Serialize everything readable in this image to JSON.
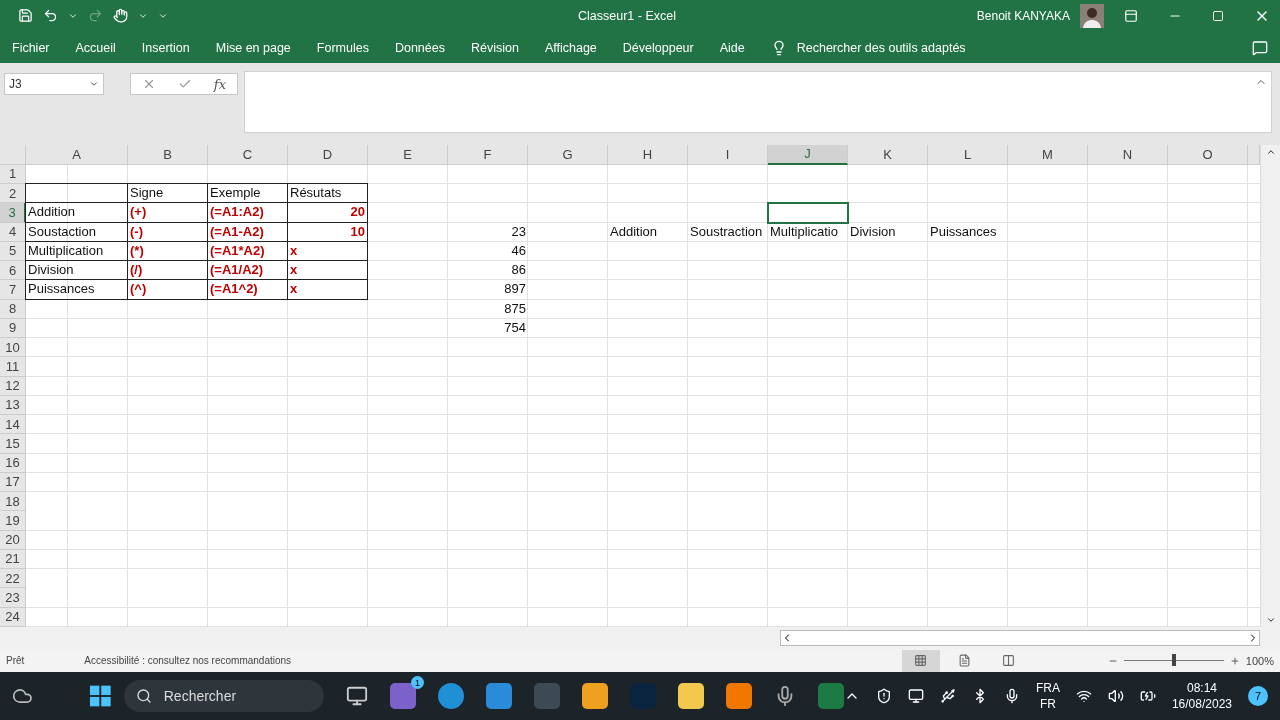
{
  "window": {
    "title": "Classeur1  -  Excel",
    "user": "Benoit KANYAKA"
  },
  "ribbon_tabs": [
    "Fichier",
    "Accueil",
    "Insertion",
    "Mise en page",
    "Formules",
    "Données",
    "Révision",
    "Affichage",
    "Développeur",
    "Aide"
  ],
  "tell_me": "Rechercher des outils adaptés",
  "formula_bar": {
    "name_box": "J3",
    "fx": "fx"
  },
  "sheet": {
    "columns": [
      {
        "label": "A",
        "selected": false
      },
      {
        "label": "B",
        "selected": false
      },
      {
        "label": "C",
        "selected": false
      },
      {
        "label": "D",
        "selected": false
      },
      {
        "label": "E",
        "selected": false
      },
      {
        "label": "F",
        "selected": false
      },
      {
        "label": "G",
        "selected": false
      },
      {
        "label": "H",
        "selected": false
      },
      {
        "label": "I",
        "selected": false
      },
      {
        "label": "J",
        "selected": true
      },
      {
        "label": "K",
        "selected": false
      },
      {
        "label": "L",
        "selected": false
      },
      {
        "label": "M",
        "selected": false
      },
      {
        "label": "N",
        "selected": false
      },
      {
        "label": "O",
        "selected": false
      }
    ],
    "rows": [
      {
        "label": "1",
        "selected": false
      },
      {
        "label": "2",
        "selected": false,
        "cells": [
          {
            "kind": "empty",
            "bordered": true
          },
          {
            "text": "Signe",
            "kind": "text",
            "bordered": true
          },
          {
            "text": "Exemple",
            "kind": "text",
            "bordered": true
          },
          {
            "text": "Résutats",
            "kind": "text",
            "bordered": true
          }
        ]
      },
      {
        "label": "3",
        "selected": true,
        "cells": [
          {
            "text": "Addition",
            "kind": "text",
            "bordered": true
          },
          {
            "text": "(+)",
            "kind": "red",
            "bordered": true
          },
          {
            "text": "(=A1:A2)",
            "kind": "red",
            "bordered": true
          },
          {
            "text": "20",
            "kind": "red-number",
            "bordered": true
          }
        ]
      },
      {
        "label": "4",
        "selected": false,
        "cells": [
          {
            "text": "Soustaction",
            "kind": "text",
            "bordered": true
          },
          {
            "text": "(-)",
            "kind": "red",
            "bordered": true
          },
          {
            "text": "(=A1-A2)",
            "kind": "red",
            "bordered": true
          },
          {
            "text": "10",
            "kind": "red-number",
            "bordered": true
          },
          {
            "kind": "empty",
            "bordered": false
          },
          {
            "text": "23",
            "kind": "number",
            "bordered": false
          },
          {
            "kind": "empty",
            "bordered": false
          },
          {
            "text": "Addition",
            "kind": "text",
            "bordered": false
          },
          {
            "text": "Soustraction",
            "kind": "text",
            "bordered": false
          },
          {
            "text": "Multiplicatio",
            "kind": "text",
            "bordered": false
          },
          {
            "text": "Division",
            "kind": "text",
            "bordered": false
          },
          {
            "text": "Puissances",
            "kind": "text",
            "bordered": false
          }
        ]
      },
      {
        "label": "5",
        "selected": false,
        "cells": [
          {
            "text": "Multiplication",
            "kind": "text",
            "bordered": true
          },
          {
            "text": "(*)",
            "kind": "red",
            "bordered": true
          },
          {
            "text": "(=A1*A2)",
            "kind": "red",
            "bordered": true
          },
          {
            "text": "x",
            "kind": "red",
            "bordered": true
          },
          {
            "kind": "empty",
            "bordered": false
          },
          {
            "text": "46",
            "kind": "number",
            "bordered": false
          }
        ]
      },
      {
        "label": "6",
        "selected": false,
        "cells": [
          {
            "text": "Division",
            "kind": "text",
            "bordered": true
          },
          {
            "text": "(/)",
            "kind": "red",
            "bordered": true
          },
          {
            "text": "(=A1/A2)",
            "kind": "red",
            "bordered": true
          },
          {
            "text": "x",
            "kind": "red",
            "bordered": true
          },
          {
            "kind": "empty",
            "bordered": false
          },
          {
            "text": "86",
            "kind": "number",
            "bordered": false
          }
        ]
      },
      {
        "label": "7",
        "selected": false,
        "cells": [
          {
            "text": "Puissances",
            "kind": "text",
            "bordered": true
          },
          {
            "text": "(^)",
            "kind": "red",
            "bordered": true
          },
          {
            "text": "(=A1^2)",
            "kind": "red",
            "bordered": true
          },
          {
            "text": "x",
            "kind": "red",
            "bordered": true
          },
          {
            "kind": "empty",
            "bordered": false
          },
          {
            "text": "897",
            "kind": "number",
            "bordered": false
          }
        ]
      },
      {
        "label": "8",
        "selected": false,
        "cells": [
          {
            "kind": "empty",
            "bordered": false
          },
          {
            "kind": "empty",
            "bordered": false
          },
          {
            "kind": "empty",
            "bordered": false
          },
          {
            "kind": "empty",
            "bordered": false
          },
          {
            "kind": "empty",
            "bordered": false
          },
          {
            "text": "875",
            "kind": "number",
            "bordered": false
          }
        ]
      },
      {
        "label": "9",
        "selected": false,
        "cells": [
          {
            "kind": "empty",
            "bordered": false
          },
          {
            "kind": "empty",
            "bordered": false
          },
          {
            "kind": "empty",
            "bordered": false
          },
          {
            "kind": "empty",
            "bordered": false
          },
          {
            "kind": "empty",
            "bordered": false
          },
          {
            "text": "754",
            "kind": "number",
            "bordered": false
          }
        ]
      },
      {
        "label": "10",
        "selected": false
      },
      {
        "label": "11",
        "selected": false
      },
      {
        "label": "12",
        "selected": false
      },
      {
        "label": "13",
        "selected": false
      },
      {
        "label": "14",
        "selected": false
      },
      {
        "label": "15",
        "selected": false
      },
      {
        "label": "16",
        "selected": false
      },
      {
        "label": "17",
        "selected": false
      },
      {
        "label": "18",
        "selected": false
      },
      {
        "label": "19",
        "selected": false
      },
      {
        "label": "20",
        "selected": false
      },
      {
        "label": "21",
        "selected": false
      },
      {
        "label": "22",
        "selected": false
      },
      {
        "label": "23",
        "selected": false
      },
      {
        "label": "24",
        "selected": false
      }
    ]
  },
  "status_bar": {
    "status": "Prêt",
    "accessibility": "Accessibilité : consultez nos recommandations",
    "views": [
      {
        "kind": "normal",
        "selected": true
      },
      {
        "kind": "layout",
        "selected": false
      },
      {
        "kind": "break",
        "selected": false
      }
    ],
    "zoom": {
      "level": 0.5,
      "reading": "100%"
    }
  },
  "taskbar": {
    "search": "Rechercher",
    "chat_badge": "1",
    "language": "FRA",
    "layout": "FR",
    "time": "08:14",
    "date": "16/08/2023",
    "notifications": "7"
  }
}
